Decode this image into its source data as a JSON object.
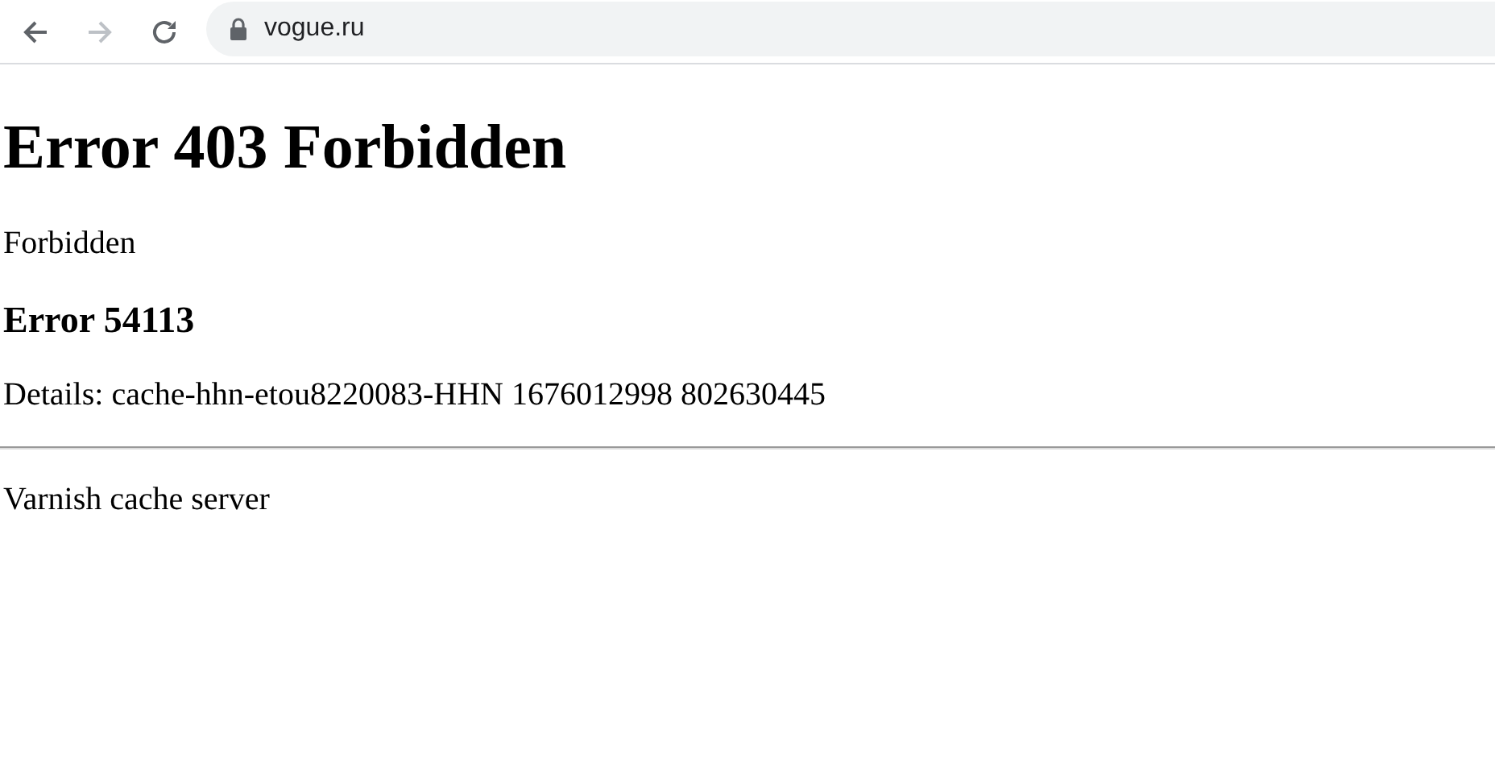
{
  "toolbar": {
    "back": {
      "disabled": false
    },
    "forward": {
      "disabled": true
    },
    "address": "vogue.ru"
  },
  "page": {
    "title": "Error 403 Forbidden",
    "message": "Forbidden",
    "error_code": "Error 54113",
    "details": "Details: cache-hhn-etou8220083-HHN 1676012998 802630445",
    "footer": "Varnish cache server"
  }
}
